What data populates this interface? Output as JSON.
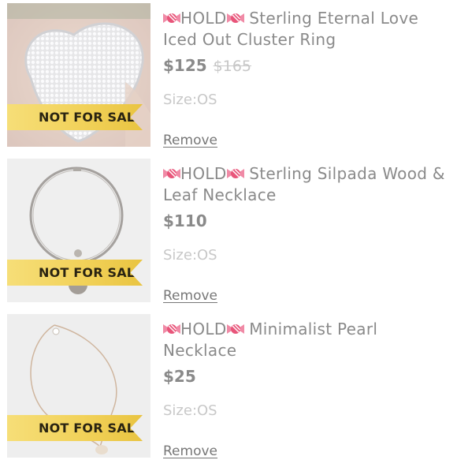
{
  "items": [
    {
      "hold_text": "HOLD",
      "name": "Sterling Eternal Love Iced Out Cluster Ring",
      "price": "$125",
      "original_price": "$165",
      "size": "Size:OS",
      "badge": "NOT FOR SALE",
      "remove_label": "Remove",
      "hold_icon": "candy-icon"
    },
    {
      "hold_text": "HOLD",
      "name": "Sterling Silpada Wood & Leaf Necklace",
      "price": "$110",
      "size": "Size:OS",
      "badge": "NOT FOR SALE",
      "remove_label": "Remove",
      "hold_icon": "candy-icon"
    },
    {
      "hold_text": "HOLD",
      "name": "Minimalist Pearl Necklace",
      "price": "$25",
      "size": "Size:OS",
      "badge": "NOT FOR SALE",
      "remove_label": "Remove",
      "hold_icon": "candy-icon"
    }
  ],
  "colors": {
    "badge": "#f2d25a",
    "text": "#8a8a8a",
    "candy": "#e8557a"
  }
}
